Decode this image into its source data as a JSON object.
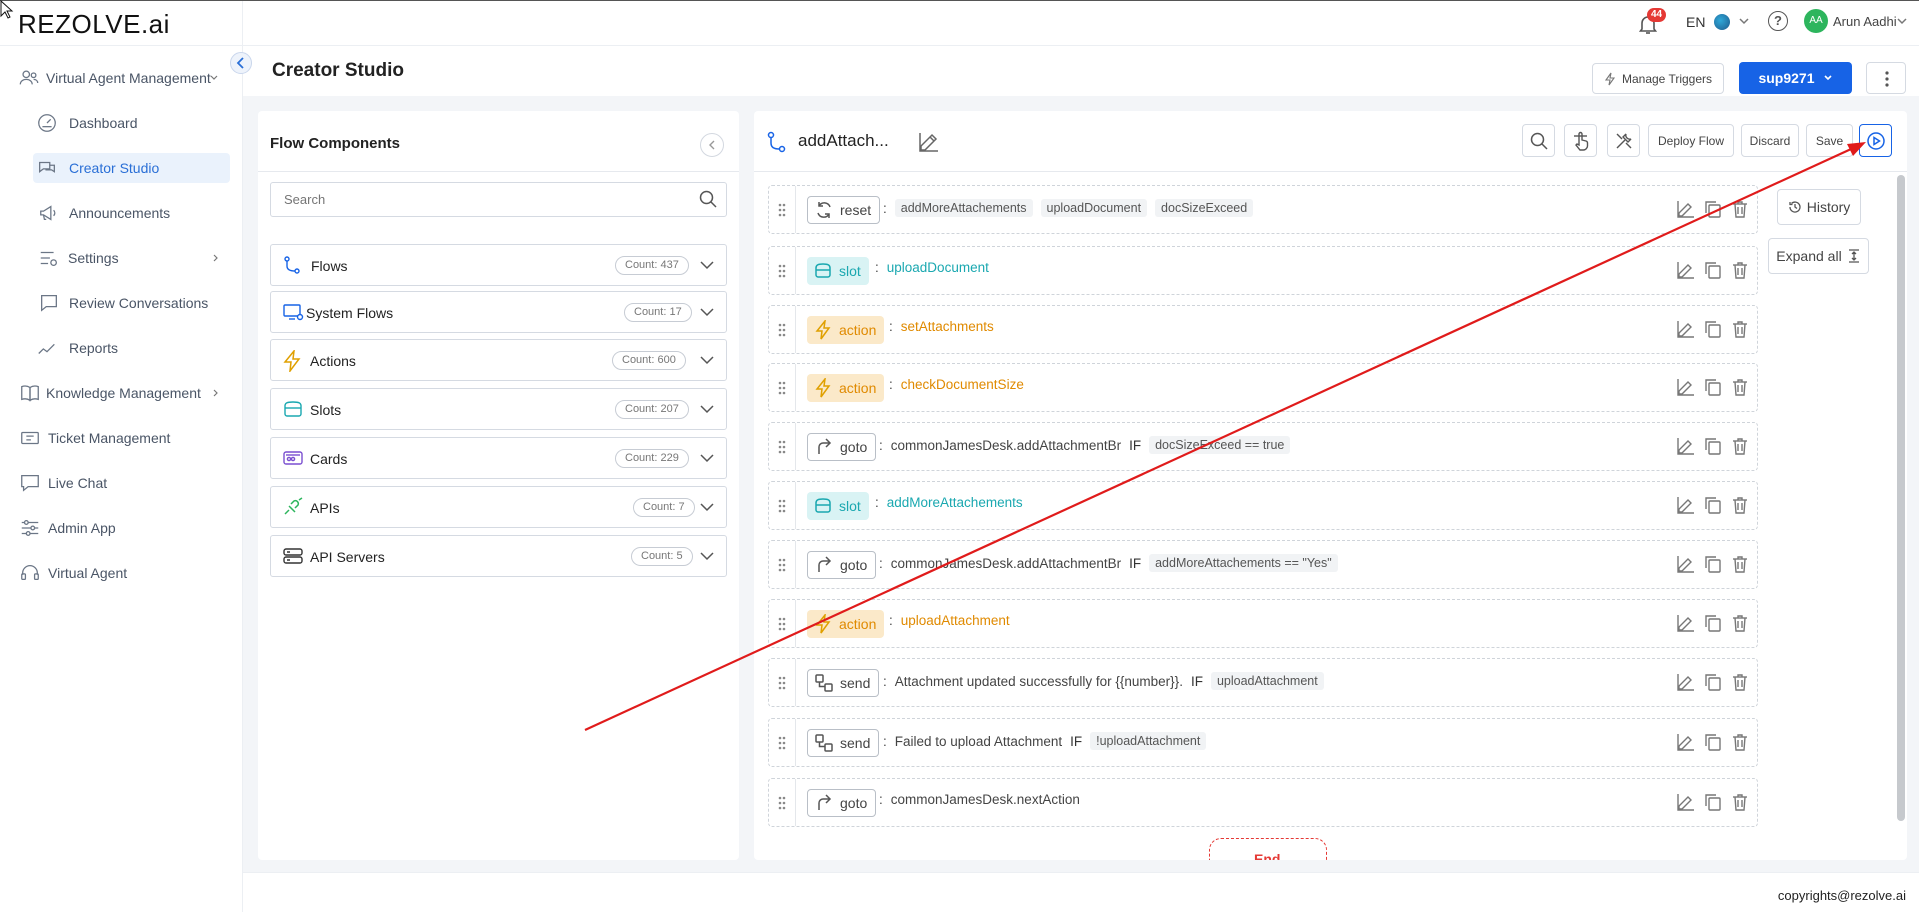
{
  "brand": {
    "logo": "REZOLVE.ai"
  },
  "topbar": {
    "notification_count": "44",
    "language": "EN",
    "user_initials": "AA",
    "user_name": "Arun Aadhi"
  },
  "sidebar": {
    "items": [
      {
        "label": "Virtual Agent Management",
        "icon": "users-icon"
      },
      {
        "label": "Dashboard",
        "icon": "gauge-icon"
      },
      {
        "label": "Creator Studio",
        "icon": "chat-bubbles-icon"
      },
      {
        "label": "Announcements",
        "icon": "megaphone-icon"
      },
      {
        "label": "Settings",
        "icon": "settings-sliders-icon"
      },
      {
        "label": "Review Conversations",
        "icon": "review-chat-icon"
      },
      {
        "label": "Reports",
        "icon": "line-chart-icon"
      },
      {
        "label": "Knowledge Management",
        "icon": "book-icon"
      },
      {
        "label": "Ticket Management",
        "icon": "ticket-icon"
      },
      {
        "label": "Live Chat",
        "icon": "live-chat-icon"
      },
      {
        "label": "Admin App",
        "icon": "sliders-icon"
      },
      {
        "label": "Virtual Agent",
        "icon": "headset-icon"
      }
    ]
  },
  "header": {
    "title": "Creator Studio",
    "manage_triggers": "Manage Triggers",
    "instance": "sup9271"
  },
  "flow_components": {
    "title": "Flow Components",
    "search_placeholder": "Search",
    "categories": [
      {
        "label": "Flows",
        "count": "Count: 437"
      },
      {
        "label": "System Flows",
        "count": "Count: 17"
      },
      {
        "label": "Actions",
        "count": "Count: 600"
      },
      {
        "label": "Slots",
        "count": "Count: 207"
      },
      {
        "label": "Cards",
        "count": "Count: 229"
      },
      {
        "label": "APIs",
        "count": "Count: 7"
      },
      {
        "label": "API Servers",
        "count": "Count: 5"
      }
    ]
  },
  "editor": {
    "flow_name": "addAttach...",
    "deploy": "Deploy Flow",
    "discard": "Discard",
    "save": "Save",
    "history": "History",
    "expand_all": "Expand all",
    "end_label": "End",
    "steps": [
      {
        "kw": "reset",
        "colon": ":",
        "tags": [
          "addMoreAttachements",
          "uploadDocument",
          "docSizeExceed"
        ]
      },
      {
        "kw": "slot",
        "colon": ":",
        "value": "uploadDocument"
      },
      {
        "kw": "action",
        "colon": ":",
        "value": "setAttachments"
      },
      {
        "kw": "action",
        "colon": ":",
        "value": "checkDocumentSize"
      },
      {
        "kw": "goto",
        "colon": ":",
        "text": "commonJamesDesk.addAttachmentBr",
        "if": "IF",
        "cond": "docSizeExceed == true"
      },
      {
        "kw": "slot",
        "colon": ":",
        "value": "addMoreAttachements"
      },
      {
        "kw": "goto",
        "colon": ":",
        "text": "commonJamesDesk.addAttachmentBr",
        "if": "IF",
        "cond": "addMoreAttachements == \"Yes\""
      },
      {
        "kw": "action",
        "colon": ":",
        "value": "uploadAttachment"
      },
      {
        "kw": "send",
        "colon": ":",
        "text": "Attachment updated successfully for {{number}}.",
        "if": "IF",
        "cond": "uploadAttachment"
      },
      {
        "kw": "send",
        "colon": ":",
        "text": "Failed to upload Attachment",
        "if": "IF",
        "cond": "!uploadAttachment"
      },
      {
        "kw": "goto",
        "colon": ":",
        "text": "commonJamesDesk.nextAction"
      }
    ]
  },
  "footer": {
    "copyright": "copyrights@rezolve.ai"
  },
  "colors": {
    "primary": "#1763e6",
    "slot": "#1aa8b0",
    "action": "#e08a00",
    "annotation_arrow": "#e01b1b"
  }
}
